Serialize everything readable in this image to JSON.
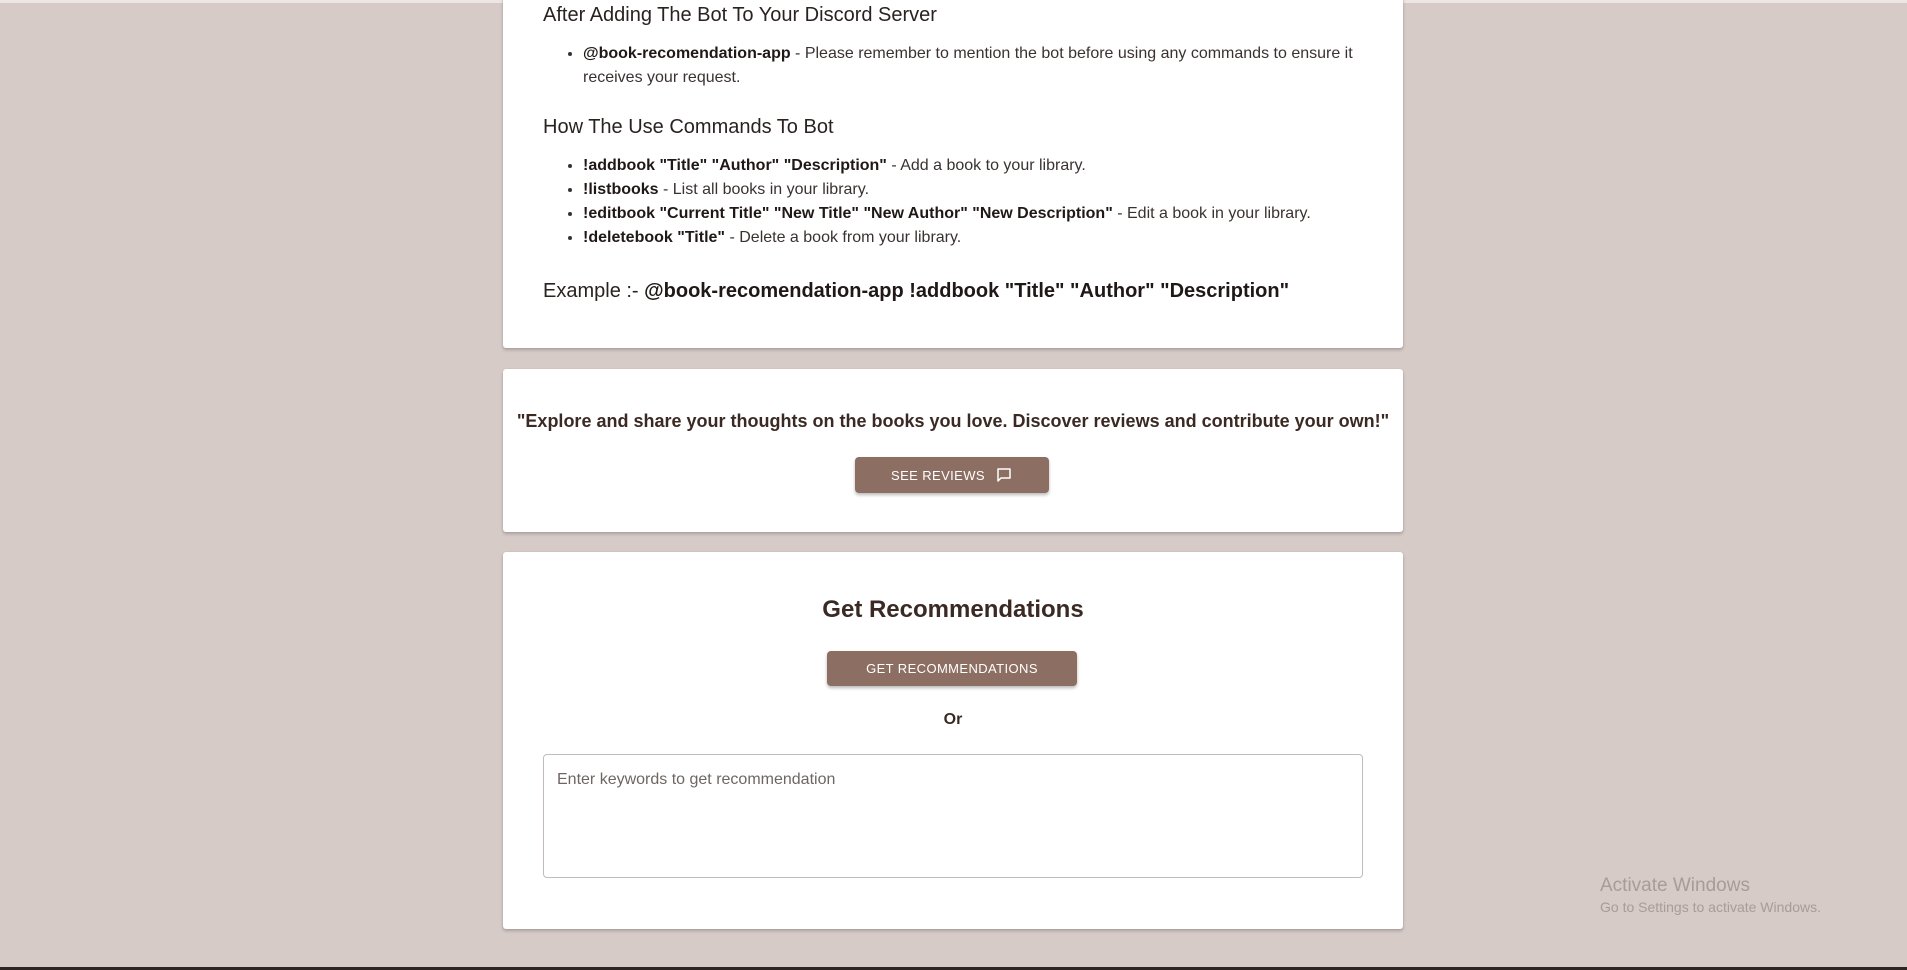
{
  "bot_card": {
    "after_heading": "After Adding The Bot To Your Discord Server",
    "mention_name": "@book-recomendation-app",
    "mention_text": " - Please remember to mention the bot before using any commands to ensure it receives your request.",
    "commands_heading": "How The Use Commands To Bot",
    "commands": [
      {
        "cmd": "!addbook \"Title\" \"Author\" \"Description\"",
        "desc": " - Add a book to your library."
      },
      {
        "cmd": "!listbooks",
        "desc": " - List all books in your library."
      },
      {
        "cmd": "!editbook \"Current Title\" \"New Title\" \"New Author\" \"New Description\"",
        "desc": " - Edit a book in your library."
      },
      {
        "cmd": "!deletebook \"Title\"",
        "desc": " - Delete a book from your library."
      }
    ],
    "example_label": "Example :- ",
    "example_code": "@book-recomendation-app !addbook \"Title\" \"Author\" \"Description\""
  },
  "reviews_card": {
    "quote": "\"Explore and share your thoughts on the books you love. Discover reviews and contribute your own!\"",
    "button_label": "SEE REVIEWS",
    "button_icon": "comment-icon"
  },
  "reco_card": {
    "title": "Get Recommendations",
    "button_label": "GET RECOMMENDATIONS",
    "or_text": "Or",
    "keywords_placeholder": "Enter keywords to get recommendation",
    "keywords_value": ""
  },
  "watermark": {
    "line1": "Activate Windows",
    "line2": "Go to Settings to activate Windows."
  },
  "colors": {
    "background": "#d7cbc8",
    "accent": "#8d6e63",
    "heading": "#3b2a24"
  }
}
